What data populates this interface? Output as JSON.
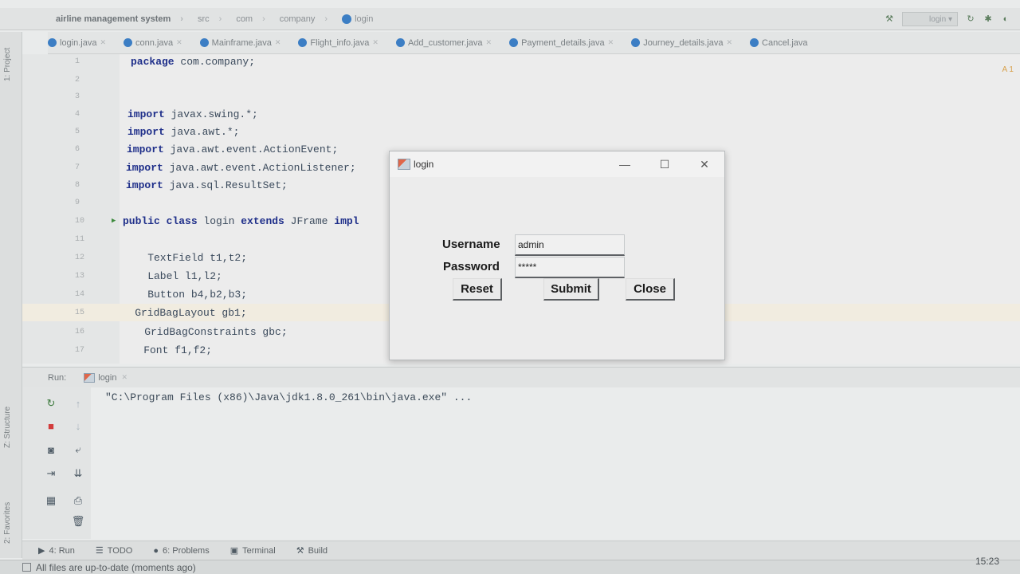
{
  "breadcrumb": {
    "app": "airline management system",
    "items": [
      "src",
      "com",
      "company"
    ],
    "file": "login"
  },
  "toolbar": {
    "run_config": "login"
  },
  "tabs": [
    {
      "label": "login.java"
    },
    {
      "label": "conn.java"
    },
    {
      "label": "Mainframe.java"
    },
    {
      "label": "Flight_info.java"
    },
    {
      "label": "Add_customer.java"
    },
    {
      "label": "Payment_details.java"
    },
    {
      "label": "Journey_details.java"
    },
    {
      "label": "Cancel.java"
    }
  ],
  "side_labels": {
    "project": "1: Project",
    "structure": "Z: Structure",
    "favorites": "2: Favorites"
  },
  "editor": {
    "warning": "A 1",
    "lines": [
      {
        "n": "1",
        "code": "package com.company;"
      },
      {
        "n": "2",
        "code": ""
      },
      {
        "n": "3",
        "code": ""
      },
      {
        "n": "4",
        "code": "import javax.swing.*;"
      },
      {
        "n": "5",
        "code": "import java.awt.*;"
      },
      {
        "n": "6",
        "code": "import java.awt.event.ActionEvent;"
      },
      {
        "n": "7",
        "code": "import java.awt.event.ActionListener;"
      },
      {
        "n": "8",
        "code": "import java.sql.ResultSet;"
      },
      {
        "n": "9",
        "code": ""
      },
      {
        "n": "10",
        "code": "public class login extends JFrame impl"
      },
      {
        "n": "11",
        "code": ""
      },
      {
        "n": "12",
        "code": "    TextField t1,t2;"
      },
      {
        "n": "13",
        "code": "    Label l1,l2;"
      },
      {
        "n": "14",
        "code": "    Button b4,b2,b3;"
      },
      {
        "n": "15",
        "code": "    GridBagLayout gb1;"
      },
      {
        "n": "16",
        "code": "    GridBagConstraints gbc;"
      },
      {
        "n": "17",
        "code": "    Font f1,f2;"
      }
    ]
  },
  "dialog": {
    "title": "login",
    "username_label": "Username",
    "username_value": "admin",
    "password_label": "Password",
    "password_value": "*****",
    "reset": "Reset",
    "submit": "Submit",
    "close": "Close",
    "minimize_glyph": "—",
    "maximize_glyph": "☐",
    "close_glyph": "✕"
  },
  "run_panel": {
    "label": "Run:",
    "tab": "login",
    "console": "\"C:\\Program Files (x86)\\Java\\jdk1.8.0_261\\bin\\java.exe\" ..."
  },
  "bottom_tabs": [
    {
      "label": "4: Run",
      "icon": "run-icon"
    },
    {
      "label": "TODO",
      "icon": "list-icon"
    },
    {
      "label": "6: Problems",
      "icon": "problems-icon"
    },
    {
      "label": "Terminal",
      "icon": "terminal-icon"
    },
    {
      "label": "Build",
      "icon": "hammer-icon"
    }
  ],
  "status": {
    "message": "All files are up-to-date (moments ago)",
    "clock": "15:23"
  }
}
